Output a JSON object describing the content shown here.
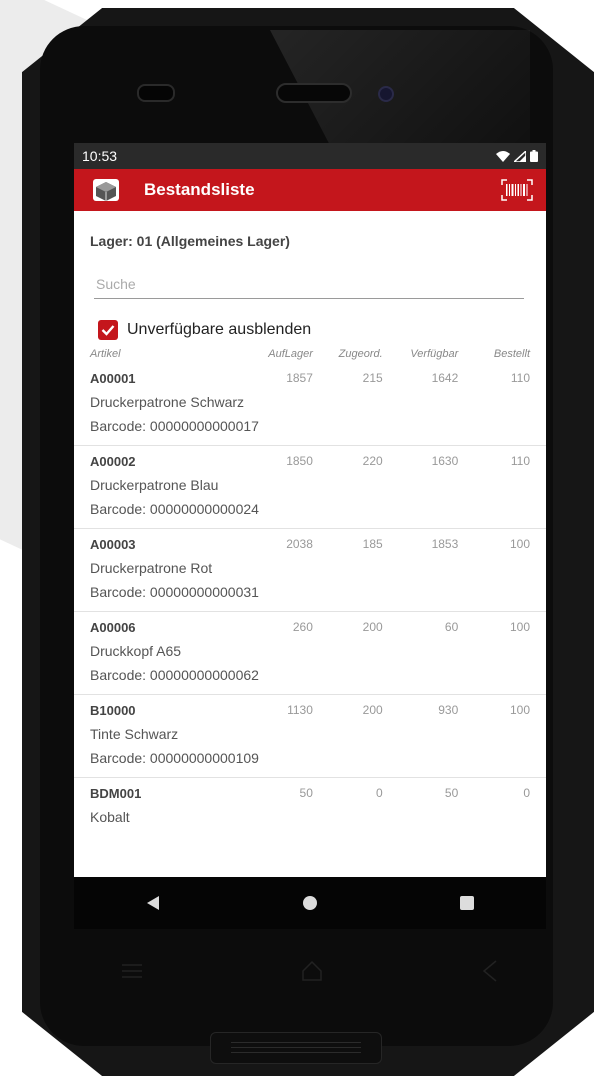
{
  "status_bar": {
    "time": "10:53"
  },
  "app_bar": {
    "title": "Bestandsliste"
  },
  "lager_label": "Lager: 01 (Allgemeines Lager)",
  "search": {
    "placeholder": "Suche",
    "value": ""
  },
  "filter": {
    "label": "Unverfügbare ausblenden",
    "checked": true
  },
  "table": {
    "headers": [
      "Artikel",
      "AufLager",
      "Zugeord.",
      "Verfügbar",
      "Bestellt"
    ],
    "rows": [
      {
        "code": "A00001",
        "auf_lager": "1857",
        "zugeord": "215",
        "verfuegbar": "1642",
        "bestellt": "110",
        "name": "Druckerpatrone Schwarz",
        "barcode": "Barcode: 00000000000017"
      },
      {
        "code": "A00002",
        "auf_lager": "1850",
        "zugeord": "220",
        "verfuegbar": "1630",
        "bestellt": "110",
        "name": "Druckerpatrone Blau",
        "barcode": "Barcode: 00000000000024"
      },
      {
        "code": "A00003",
        "auf_lager": "2038",
        "zugeord": "185",
        "verfuegbar": "1853",
        "bestellt": "100",
        "name": "Druckerpatrone Rot",
        "barcode": "Barcode: 00000000000031"
      },
      {
        "code": "A00006",
        "auf_lager": "260",
        "zugeord": "200",
        "verfuegbar": "60",
        "bestellt": "100",
        "name": "Druckkopf A65",
        "barcode": "Barcode: 00000000000062"
      },
      {
        "code": "B10000",
        "auf_lager": "1130",
        "zugeord": "200",
        "verfuegbar": "930",
        "bestellt": "100",
        "name": "Tinte Schwarz",
        "barcode": "Barcode: 00000000000109"
      },
      {
        "code": "BDM001",
        "auf_lager": "50",
        "zugeord": "0",
        "verfuegbar": "50",
        "bestellt": "0",
        "name": "Kobalt",
        "barcode": ""
      }
    ]
  },
  "colors": {
    "accent": "#c4161c",
    "status_bar": "#2a2a2a",
    "nav_bar": "#050505"
  },
  "icons": [
    "warehouse-box-icon",
    "barcode-scanner-icon",
    "wifi-icon",
    "signal-icon",
    "battery-icon",
    "back-icon",
    "home-icon",
    "recents-icon",
    "menu-key-icon",
    "home-key-icon",
    "back-key-icon"
  ]
}
